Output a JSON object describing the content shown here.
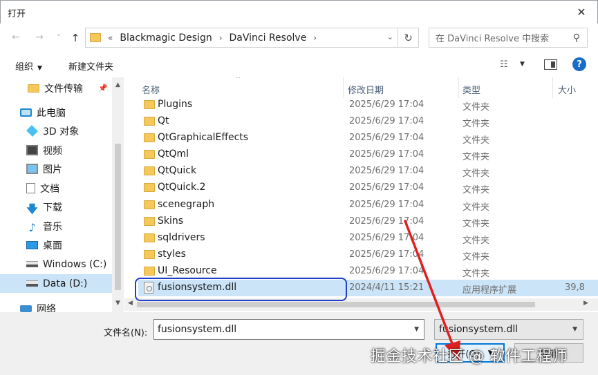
{
  "window": {
    "title": "打开",
    "close_glyph": "✕"
  },
  "nav": {
    "back_glyph": "←",
    "forward_glyph": "→",
    "recent_glyph": "⌄",
    "up_glyph": "↑",
    "address": {
      "chevron_left": "«",
      "crumbs": [
        "Blackmagic Design",
        "DaVinci Resolve"
      ],
      "sep": "›",
      "refresh_glyph": "↻",
      "dropdown_glyph": "⌄"
    },
    "search": {
      "placeholder": "在 DaVinci Resolve 中搜索",
      "icon_glyph": "⚲"
    }
  },
  "toolbar": {
    "organize_label": "组织",
    "organize_caret": "▼",
    "new_folder_label": "新建文件夹",
    "view_glyph": "☷",
    "view_caret": "▼",
    "help_glyph": "?"
  },
  "sidebar": {
    "pin_glyph": "📌",
    "down_glyph": "🡇",
    "music_glyph": "♪",
    "items": [
      {
        "label": "文件传输",
        "icon": "folder-icon"
      },
      {
        "label": "此电脑",
        "icon": "computer-icon"
      },
      {
        "label": "3D 对象",
        "icon": "3d-objects-icon"
      },
      {
        "label": "视频",
        "icon": "video-icon"
      },
      {
        "label": "图片",
        "icon": "pictures-icon"
      },
      {
        "label": "文档",
        "icon": "documents-icon"
      },
      {
        "label": "下载",
        "icon": "download-icon"
      },
      {
        "label": "音乐",
        "icon": "music-icon"
      },
      {
        "label": "桌面",
        "icon": "desktop-icon"
      },
      {
        "label": "Windows (C:)",
        "icon": "drive-icon"
      },
      {
        "label": "Data (D:)",
        "icon": "drive-icon",
        "selected": true
      },
      {
        "label": "网络",
        "icon": "network-icon"
      }
    ],
    "scroll_up_glyph": "▲",
    "scroll_down_glyph": "▼"
  },
  "columns": {
    "name": "名称",
    "modified": "修改日期",
    "type": "类型",
    "size": "大小",
    "sort_glyph": "^"
  },
  "files": [
    {
      "name": "Plugins",
      "date": "2025/6/29 17:04",
      "type": "文件夹",
      "size": ""
    },
    {
      "name": "Qt",
      "date": "2025/6/29 17:04",
      "type": "文件夹",
      "size": ""
    },
    {
      "name": "QtGraphicalEffects",
      "date": "2025/6/29 17:04",
      "type": "文件夹",
      "size": ""
    },
    {
      "name": "QtQml",
      "date": "2025/6/29 17:04",
      "type": "文件夹",
      "size": ""
    },
    {
      "name": "QtQuick",
      "date": "2025/6/29 17:04",
      "type": "文件夹",
      "size": ""
    },
    {
      "name": "QtQuick.2",
      "date": "2025/6/29 17:04",
      "type": "文件夹",
      "size": ""
    },
    {
      "name": "scenegraph",
      "date": "2025/6/29 17:04",
      "type": "文件夹",
      "size": ""
    },
    {
      "name": "Skins",
      "date": "2025/6/29 17:04",
      "type": "文件夹",
      "size": ""
    },
    {
      "name": "sqldrivers",
      "date": "2025/6/29 17:04",
      "type": "文件夹",
      "size": ""
    },
    {
      "name": "styles",
      "date": "2025/6/29 17:04",
      "type": "文件夹",
      "size": ""
    },
    {
      "name": "UI_Resource",
      "date": "2025/6/29 17:04",
      "type": "文件夹",
      "size": ""
    },
    {
      "name": "fusionsystem.dll",
      "date": "2024/4/11 15:21",
      "type": "应用程序扩展",
      "size": "39,8",
      "selected": true
    }
  ],
  "hscroll": {
    "left_glyph": "◀",
    "right_glyph": "▶"
  },
  "bottom": {
    "filename_label": "文件名(N):",
    "filename_value": "fusionsystem.dll",
    "filename_dd": "▼",
    "filter_value": "fusionsystem.dll",
    "filter_dd": "▼",
    "open_label": "打开(O)",
    "open_caret": "▼",
    "cancel_label": "取消"
  },
  "watermark": "掘金技术社区 @ 软件工程师",
  "annotation_colors": {
    "oval": "#1f3dc7",
    "arrow": "#e02020"
  }
}
